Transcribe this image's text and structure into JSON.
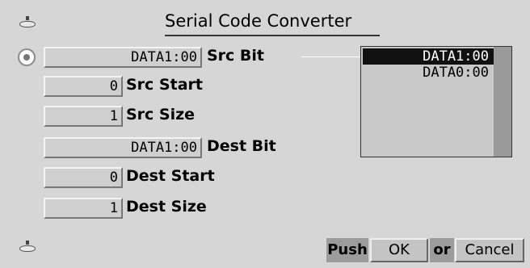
{
  "dialog": {
    "title": "Serial Code Converter"
  },
  "fields": [
    {
      "value": "DATA1:00",
      "label": "Src Bit"
    },
    {
      "value": "0",
      "label": "Src Start"
    },
    {
      "value": "1",
      "label": "Src Size"
    },
    {
      "value": "DATA1:00",
      "label": "Dest Bit"
    },
    {
      "value": "0",
      "label": "Dest Start"
    },
    {
      "value": "1",
      "label": "Dest Size"
    }
  ],
  "list": {
    "items": [
      "DATA1:00",
      "DATA0:00"
    ],
    "selected_index": 0
  },
  "footer": {
    "push_label": "Push",
    "ok_label": "OK",
    "or_label": "or",
    "cancel_label": "Cancel"
  }
}
